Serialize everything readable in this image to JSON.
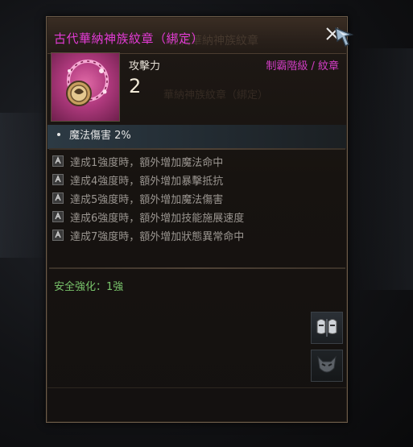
{
  "tooltip": {
    "title": "古代華納神族紋章（綁定）",
    "title_ghost": "古代華納神族紋章",
    "close_icon": "close-icon",
    "cursor_icon": "cursor-arrow-icon",
    "attribute": {
      "label": "攻擊力",
      "value": "2"
    },
    "grade": "制霸階級 / 紋章",
    "ghost_text": "華納神族紋章（綁定）",
    "main_stat": "魔法傷害  2%",
    "enhancement_bonuses": [
      {
        "text": "達成1強度時，額外增加魔法命中",
        "icon": "enhance-level-icon"
      },
      {
        "text": "達成4強度時，額外增加暴擊抵抗",
        "icon": "enhance-level-icon"
      },
      {
        "text": "達成5強度時，額外增加魔法傷害",
        "icon": "enhance-level-icon"
      },
      {
        "text": "達成6強度時，額外增加技能施展速度",
        "icon": "enhance-level-icon"
      },
      {
        "text": "達成7強度時，額外增加狀態異常命中",
        "icon": "enhance-level-icon"
      }
    ],
    "safe_enhancement": "安全強化：1強",
    "buttons": [
      {
        "name": "compare-button",
        "icon": "compare-masks-icon"
      },
      {
        "name": "appearance-button",
        "icon": "demon-mask-icon"
      }
    ],
    "colors": {
      "title": "#e43bd6",
      "grade": "#d23dc5",
      "safe": "#79c46b",
      "text": "#9a9590"
    }
  }
}
